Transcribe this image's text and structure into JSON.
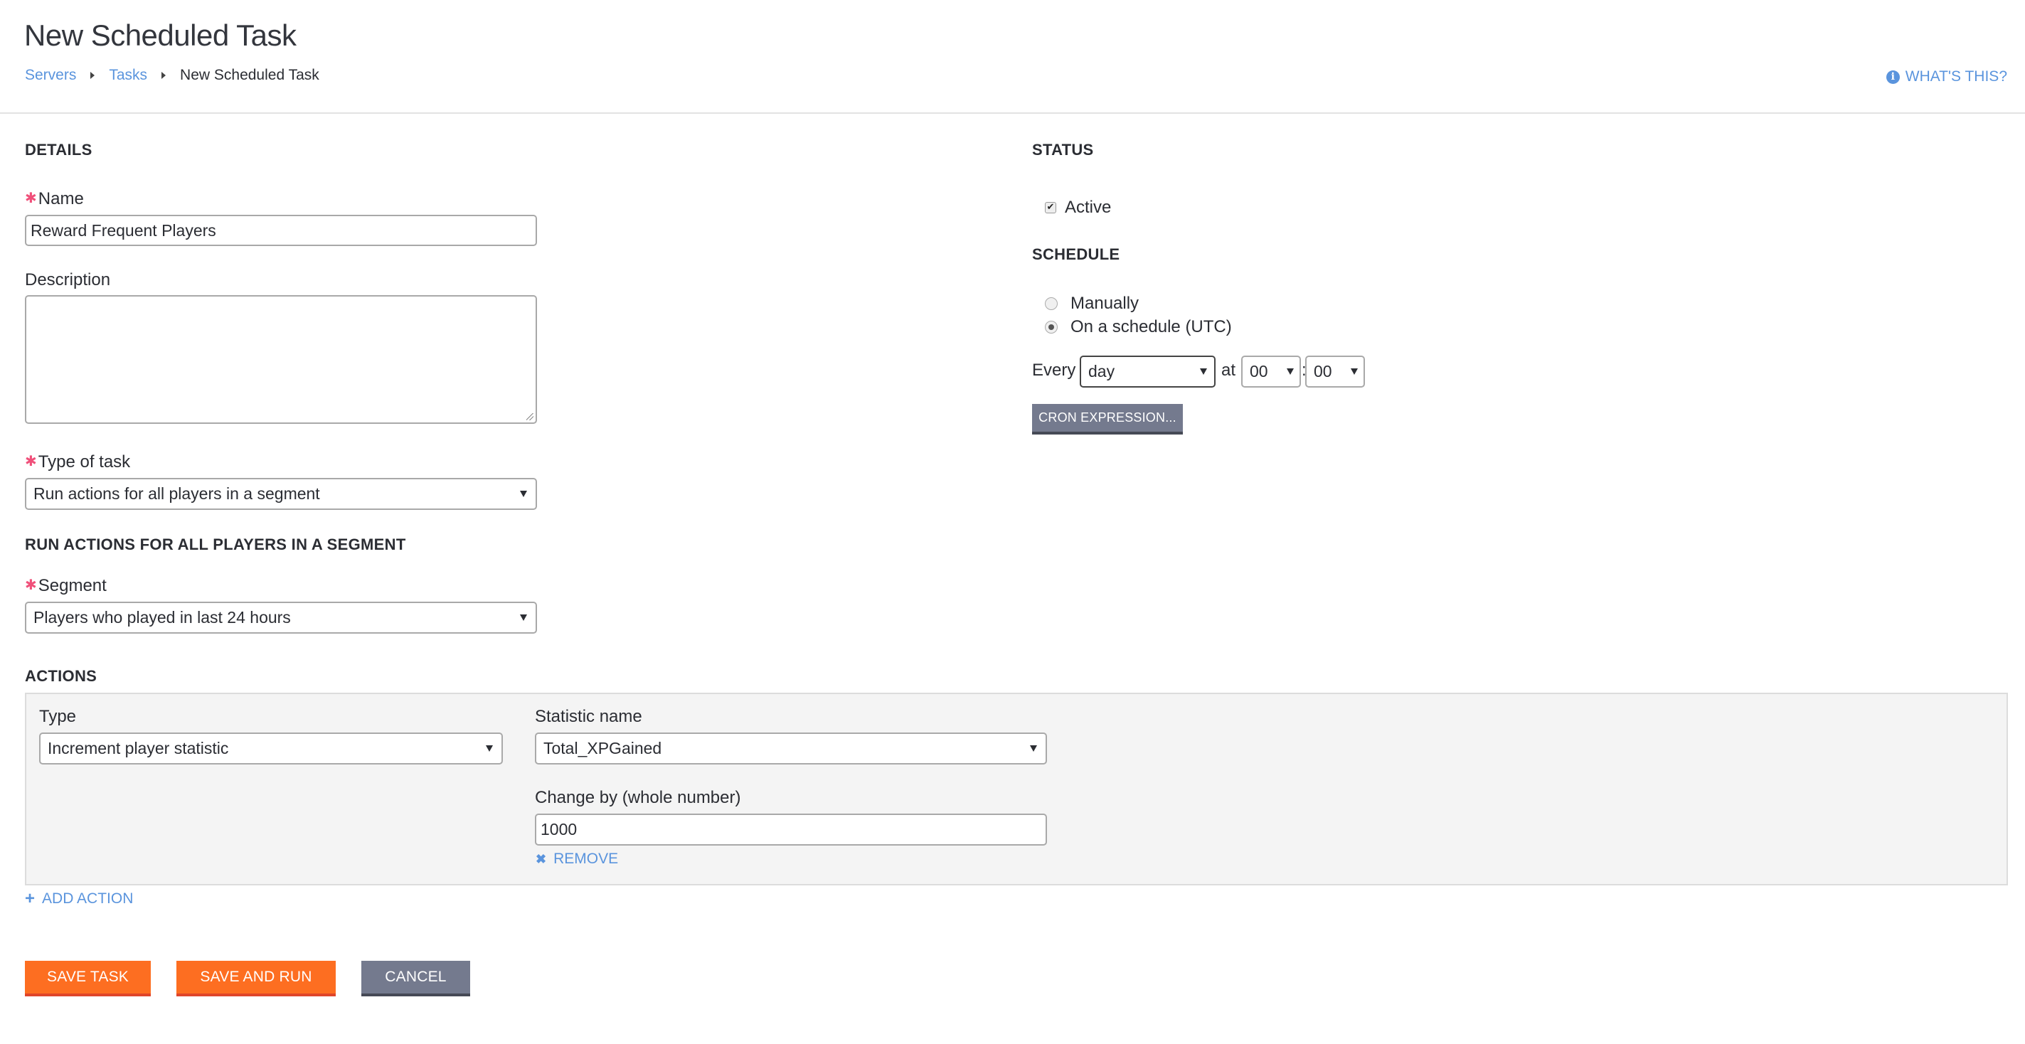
{
  "header": {
    "title": "New Scheduled Task",
    "breadcrumb": [
      {
        "label": "Servers",
        "link": true
      },
      {
        "label": "Tasks",
        "link": true
      },
      {
        "label": "New Scheduled Task",
        "link": false
      }
    ],
    "help_link": "WHAT'S THIS?",
    "help_icon": "info-icon"
  },
  "details": {
    "heading": "DETAILS",
    "name_label": "Name",
    "name_value": "Reward Frequent Players",
    "description_label": "Description",
    "description_value": "",
    "type_label": "Type of task",
    "type_value": "Run actions for all players in a segment",
    "required_marker": "✱"
  },
  "segment_section": {
    "heading": "RUN ACTIONS FOR ALL PLAYERS IN A SEGMENT",
    "segment_label": "Segment",
    "segment_value": "Players who played in last 24 hours"
  },
  "actions": {
    "heading": "ACTIONS",
    "items": [
      {
        "type_label": "Type",
        "type_value": "Increment player statistic",
        "statistic_label": "Statistic name",
        "statistic_value": "Total_XPGained",
        "change_label": "Change by (whole number)",
        "change_value": "1000",
        "remove_label": "REMOVE"
      }
    ],
    "add_label": "ADD ACTION"
  },
  "status": {
    "heading": "STATUS",
    "active_label": "Active",
    "active_checked": true
  },
  "schedule": {
    "heading": "SCHEDULE",
    "options": [
      {
        "label": "Manually",
        "selected": false
      },
      {
        "label": "On a schedule (UTC)",
        "selected": true
      }
    ],
    "every_label": "Every",
    "every_value": "day",
    "at_label": "at",
    "hour_value": "00",
    "colon": ":",
    "minute_value": "00",
    "cron_button": "CRON EXPRESSION..."
  },
  "footer": {
    "save_label": "SAVE TASK",
    "save_run_label": "SAVE AND RUN",
    "cancel_label": "CANCEL"
  },
  "colors": {
    "primary_orange": "#fd6e21",
    "secondary_gray": "#747a8e",
    "link_blue": "#5a94dd",
    "required_pink": "#f0507a"
  }
}
